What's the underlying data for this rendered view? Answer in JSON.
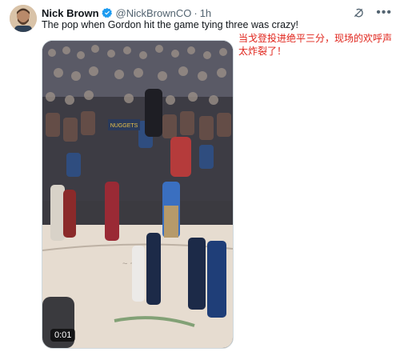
{
  "author": {
    "name": "Nick Brown",
    "handle": "@NickBrownCO",
    "time": "1h"
  },
  "tweet": {
    "text": "The pop when Gordon hit the game tying three was crazy!",
    "translation": "当戈登投进绝平三分，现场的欢呼声太炸裂了！"
  },
  "media": {
    "type": "video",
    "duration": "0:01",
    "sign_text": "NUGGETS"
  },
  "icons": {
    "verified": "verified-badge-icon",
    "grok": "grok-icon",
    "more": "more-options-icon"
  },
  "colors": {
    "verified": "#1d9bf0",
    "translation": "#e0241b"
  },
  "header": {
    "separator": "·",
    "more_glyph": "•••"
  }
}
